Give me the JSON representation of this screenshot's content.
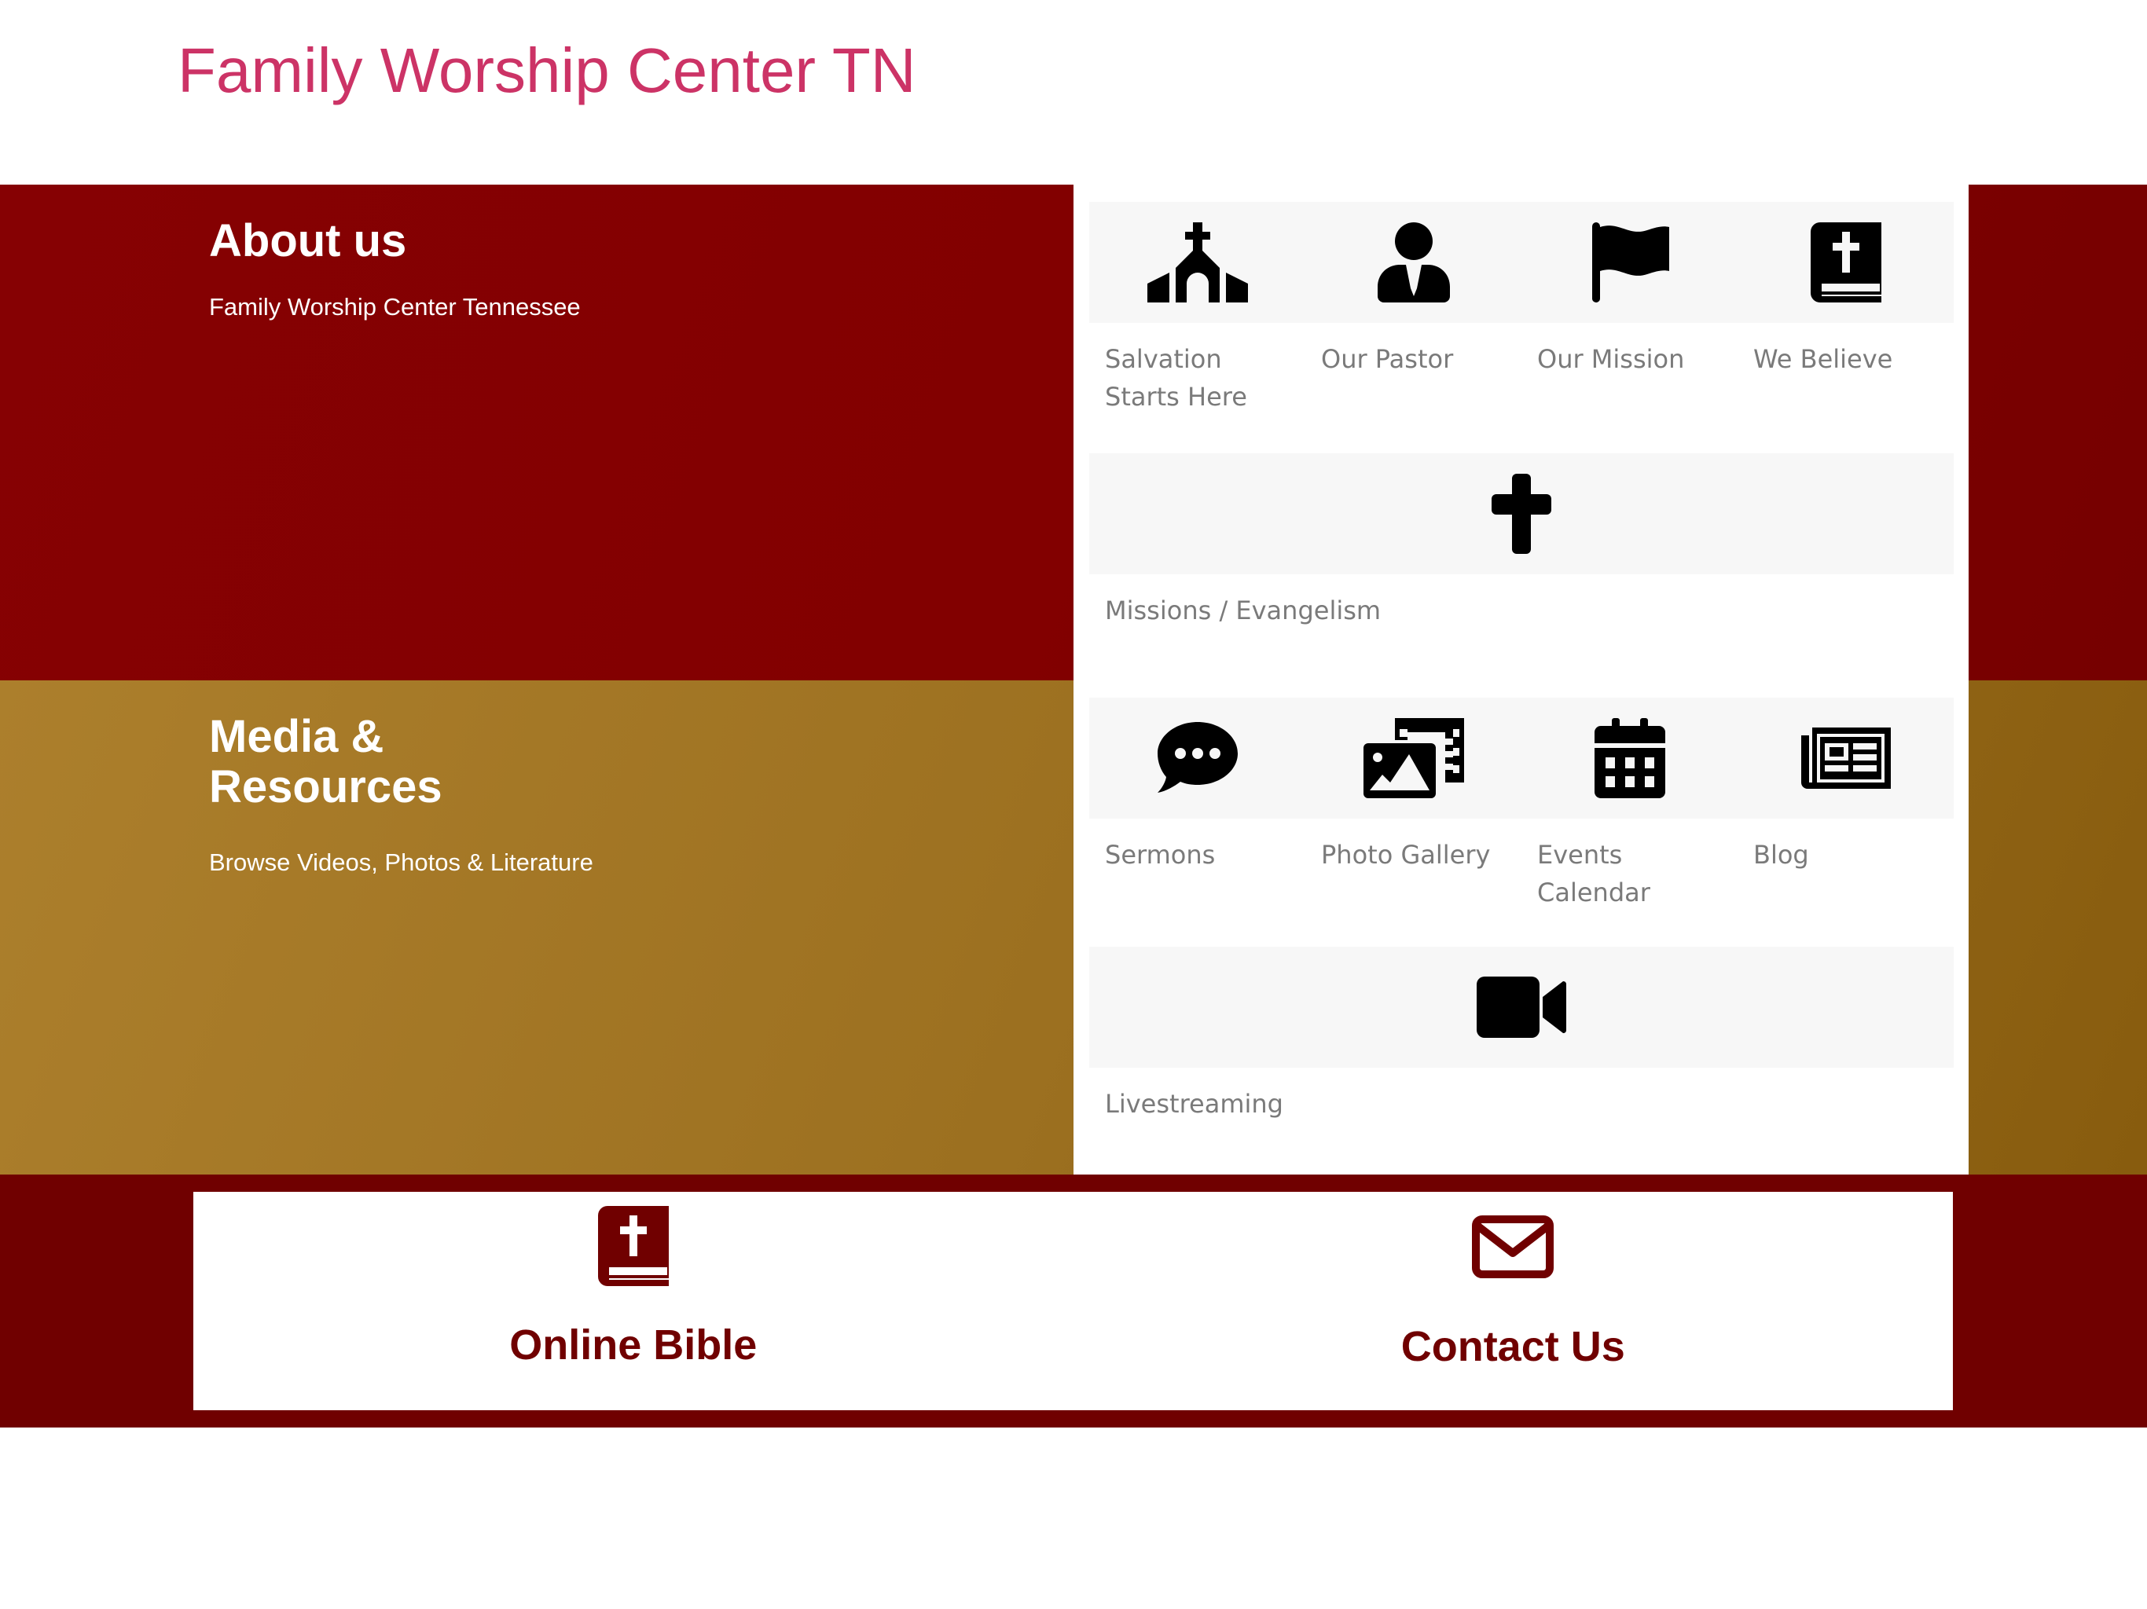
{
  "header": {
    "site_title": "Family Worship Center TN"
  },
  "colors": {
    "title": "#cc3366",
    "about_band": "#820000",
    "media_band": "#9c7020",
    "footer_band": "#700000",
    "tile_bg": "#f7f7f7",
    "tile_label": "#7a7a7a",
    "link_text": "#700000"
  },
  "about": {
    "title": "About us",
    "subtitle": "Family Worship Center Tennessee",
    "tiles": [
      {
        "label": "Salvation Starts Here",
        "icon": "church-icon"
      },
      {
        "label": "Our Pastor",
        "icon": "user-tie-icon"
      },
      {
        "label": "Our Mission",
        "icon": "flag-icon"
      },
      {
        "label": "We Believe",
        "icon": "bible-icon"
      }
    ],
    "wide_tile": {
      "label": "Missions / Evangelism",
      "icon": "cross-icon"
    }
  },
  "media": {
    "title": "Media & Resources",
    "subtitle": "Browse Videos, Photos & Literature",
    "tiles": [
      {
        "label": "Sermons",
        "icon": "comment-dots-icon"
      },
      {
        "label": "Photo Gallery",
        "icon": "photo-video-icon"
      },
      {
        "label": "Events Calendar",
        "icon": "calendar-icon"
      },
      {
        "label": "Blog",
        "icon": "newspaper-icon"
      }
    ],
    "wide_tile": {
      "label": "Livestreaming",
      "icon": "video-icon"
    }
  },
  "links": [
    {
      "label": "Online Bible",
      "icon": "bible-icon"
    },
    {
      "label": "Contact Us",
      "icon": "envelope-icon"
    }
  ]
}
